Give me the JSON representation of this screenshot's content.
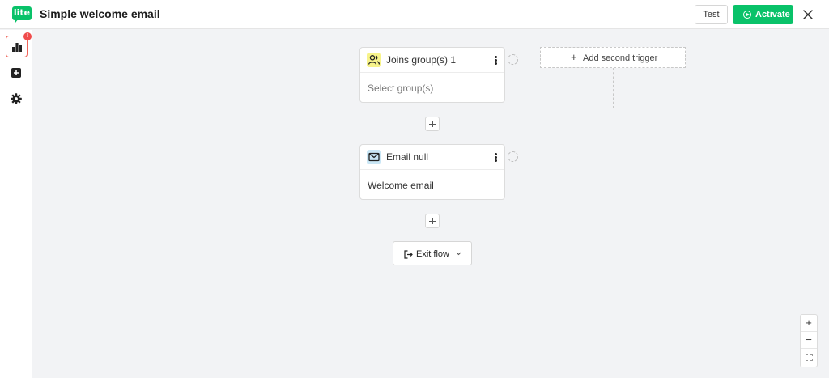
{
  "header": {
    "logo_text": "lite",
    "title": "Simple welcome email",
    "test_label": "Test",
    "activate_label": "Activate"
  },
  "sidebar": {
    "items": [
      {
        "name": "reports",
        "icon": "bar-chart-icon",
        "active": true
      },
      {
        "name": "add",
        "icon": "plus-square-icon",
        "active": false
      },
      {
        "name": "settings",
        "icon": "gear-icon",
        "active": false
      }
    ],
    "badge": "!"
  },
  "flow": {
    "trigger": {
      "title": "Joins group(s) 1",
      "body": "Select group(s)",
      "icon": "users-icon"
    },
    "second_trigger_label": "Add second trigger",
    "email": {
      "title": "Email null",
      "body": "Welcome email",
      "icon": "envelope-icon"
    },
    "exit_label": "Exit flow"
  },
  "zoom": {
    "in": "+",
    "out": "−"
  },
  "colors": {
    "brand": "#09c269",
    "badge": "#f04c4c",
    "canvas": "#f2f3f5",
    "trigger_icon_bg": "#f7f38a",
    "email_icon_bg": "#c9e6f5"
  }
}
